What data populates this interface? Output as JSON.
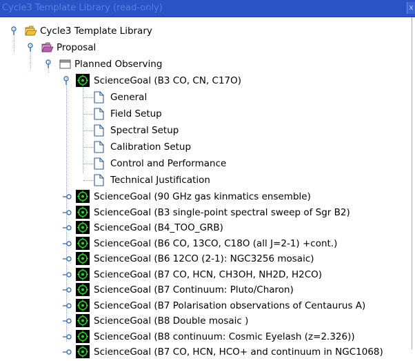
{
  "window": {
    "title": "Cycle3 Template Library  (read-only)",
    "close_glyph": "x"
  },
  "tree": {
    "root_label": "Cycle3 Template Library",
    "proposal_label": "Proposal",
    "planned_label": "Planned Observing",
    "expanded_goal_label": "ScienceGoal (B3 CO, CN, C17O)",
    "pages": [
      "General",
      "Field Setup",
      "Spectral Setup",
      "Calibration Setup",
      "Control and Performance",
      "Technical Justification"
    ],
    "goals": [
      "ScienceGoal (90 GHz gas kinmatics ensemble)",
      "ScienceGoal (B3 single-point spectral sweep of Sgr B2)",
      "ScienceGoal (B4_TOO_GRB)",
      "ScienceGoal (B6 CO, 13CO, C18O (all J=2-1) +cont.)",
      "ScienceGoal (B6 12CO (2-1): NGC3256 mosaic)",
      "ScienceGoal (B7 CO, HCN, CH3OH, NH2D, H2CO)",
      "ScienceGoal (B7 Continuum: Pluto/Charon)",
      "ScienceGoal (B7 Polarisation observations of Centaurus A)",
      "ScienceGoal (B8 Double mosaic )",
      "ScienceGoal (B8 continuum: Cosmic Eyelash (z=2.326))",
      "ScienceGoal (B7 CO, HCN, HCO+ and continuum in NGC1068)"
    ]
  },
  "colors": {
    "titlebar": "#2a54c6",
    "title_text": "#5a7fe0",
    "tree_line": "#8aa8c8",
    "goal_icon_bg": "#000000",
    "goal_icon_fg": "#22dd22"
  },
  "icons": {
    "root": "open-folder-icon",
    "proposal": "proposal-folder-icon",
    "planned": "open-folder-icon",
    "goal": "science-goal-icon",
    "page": "document-icon",
    "handle_open": "tree-expanded-handle-icon",
    "handle_closed": "tree-collapsed-handle-icon"
  }
}
